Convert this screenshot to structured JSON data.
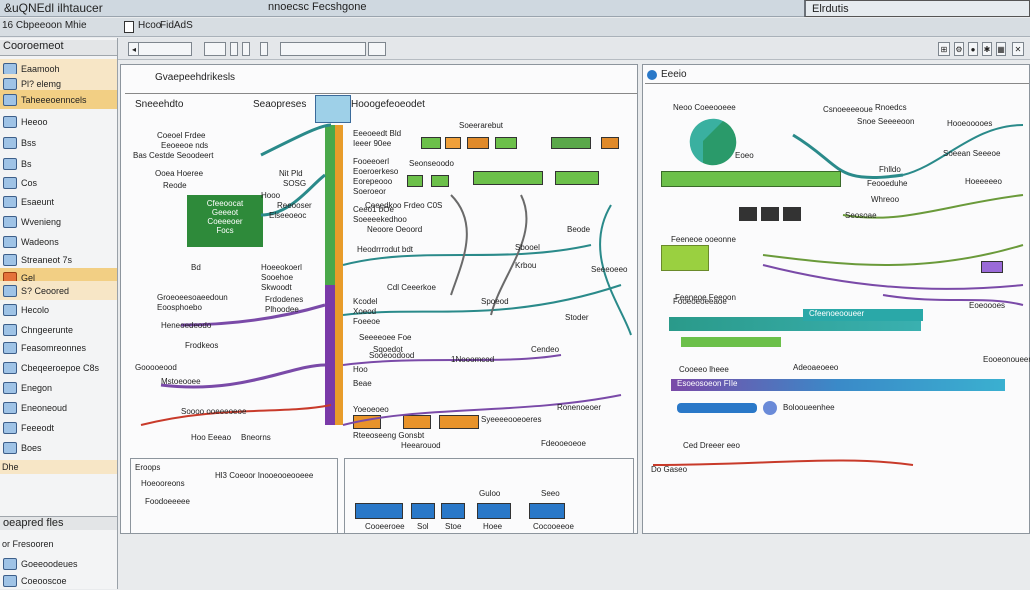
{
  "window": {
    "title": "16 Cbpeeoon Mhie",
    "title_prefix": "&uQNEdl ilhtaucer",
    "menu": "nnoecsc Fecshgone",
    "right_box": "Elrdutis"
  },
  "tabstrip": {
    "tab1": "Hcoo",
    "tab2": "FidAdS"
  },
  "sidebar": {
    "header": "Cooroemeot",
    "top_items": [
      "Eaamooh",
      "Pl? elemg",
      "Taheeeoenncels"
    ],
    "items": [
      "Heeoo",
      "Bss",
      "Bs",
      "Cos",
      "Esaeunt",
      "Wvenieng",
      "Wadeons",
      "Streaneot 7s"
    ],
    "group2": [
      "Gel",
      "S? Ceoored"
    ],
    "items2": [
      "Hecolo",
      "Chngeerunte",
      "Feasomreonnes",
      "Cbeqeeroepoe C8s",
      "Enegon",
      "Eneoneoud",
      "Feeeodt",
      "Boes"
    ],
    "footer": [
      "Dhe",
      "oeapred fles",
      "or Fresooren",
      "Goeeoodeues",
      "Coeooscoe"
    ]
  },
  "panel_left": {
    "title": "Gvaepeehdrikesls",
    "col1": "Sneeehdto",
    "col2": "Seaopreses",
    "col3": "Hooogefeoeodet",
    "labels": [
      "Coeoel Frdee",
      "Eeoeeoe nds",
      "Bas Cestde Seoodeert",
      "Ooea Hoeree",
      "Reode",
      "Nit Pld",
      "SOSG",
      "Eeeoeedt Bld",
      "Ieeer 90ee",
      "Fooeeoerl",
      "Eoeroerkeso",
      "Eorepeooo",
      "Soeroeor",
      "Seonseoodo",
      "Soeerarebut",
      "Ceeo1 bOe",
      "Soeeeekedhoo",
      "Heodrrrodut bdt",
      "Beode",
      "Sbooel",
      "Bd",
      "Hoeeokoerl",
      "Sooehoe",
      "Skwoodt",
      "Groeoeesoaeedoun",
      "Eoosphoebo",
      "Heneoedeodo",
      "Frdodenes",
      "Plhoodee",
      "Frodkeos",
      "Kcodel",
      "Xoeod",
      "Foeeoe",
      "Spoeod",
      "Stoder",
      "Sqoedot",
      "Cendeo",
      "Hoo",
      "Beae",
      "Gooooeood",
      "Mstoeooee",
      "Soooo ooeeeoeoe",
      "Yoeoeoeo",
      "Rteeoseeng Gonsbt",
      "Ronenoeoer",
      "Syeeeeooeoeres",
      "Heearouod",
      "Fdeooeoeoe",
      "Cdl Ceeerkoe",
      "Seeeoeeo",
      "Hoo Eeeao",
      "Bneorns"
    ],
    "green_box": "Cfeeoocat\nGeeeot\nCoeeeoer\nFocs",
    "notes": [
      "Hooo",
      "Reeooser",
      "Krbou",
      "Elseeoeoc"
    ],
    "rows": [
      "Ceeedkoo Frdeo C0S",
      "Neoore Oeoord",
      "1Nooomcod",
      "Sooeoodood",
      "Seeeeoee Foe"
    ]
  },
  "panel_right": {
    "title": "Eeeio",
    "labels": [
      "Neoo Coeeooeee",
      "Eoeo",
      "Rnoedcs",
      "Snoe Seeeeoon",
      "Hooeooooes",
      "Soeean Seeeoe",
      "Fhlldo",
      "Feooeduhe",
      "Hoeeeeeo",
      "Whreoo",
      "Seosoae",
      "Feeneoe ooeonne",
      "Fooeoeoeeaoe",
      "Eoeoooes",
      "Eooeonoueen",
      "Cooeeo lheee",
      "Adeoaeoeeo",
      "Feeneoe Feeoon",
      "Bolooueenhee",
      "Do Gaseo",
      "Csnoeeeeoue",
      "Ced Dreeer eeo"
    ],
    "green_label": "Cfeenoeooueer",
    "blue_label": "Esoeosoeon FIIe"
  },
  "bottom_panel": {
    "labels": [
      "Eroops",
      "Hoeooreons",
      "Foodoeeeee",
      "Hl3 Coeoor Inooeooeooeee",
      "Guloo",
      "Seeo",
      "Cooeeroee",
      "Sol",
      "Stoe",
      "Hoee",
      "Cocooeeoe"
    ]
  },
  "colors": {
    "teal": "#2a8a8a",
    "green": "#5aa84a",
    "orange": "#e8932a",
    "purple": "#7a4aa8",
    "blue": "#2a78c8",
    "red": "#c83a2a",
    "yellow": "#f2d24a"
  }
}
